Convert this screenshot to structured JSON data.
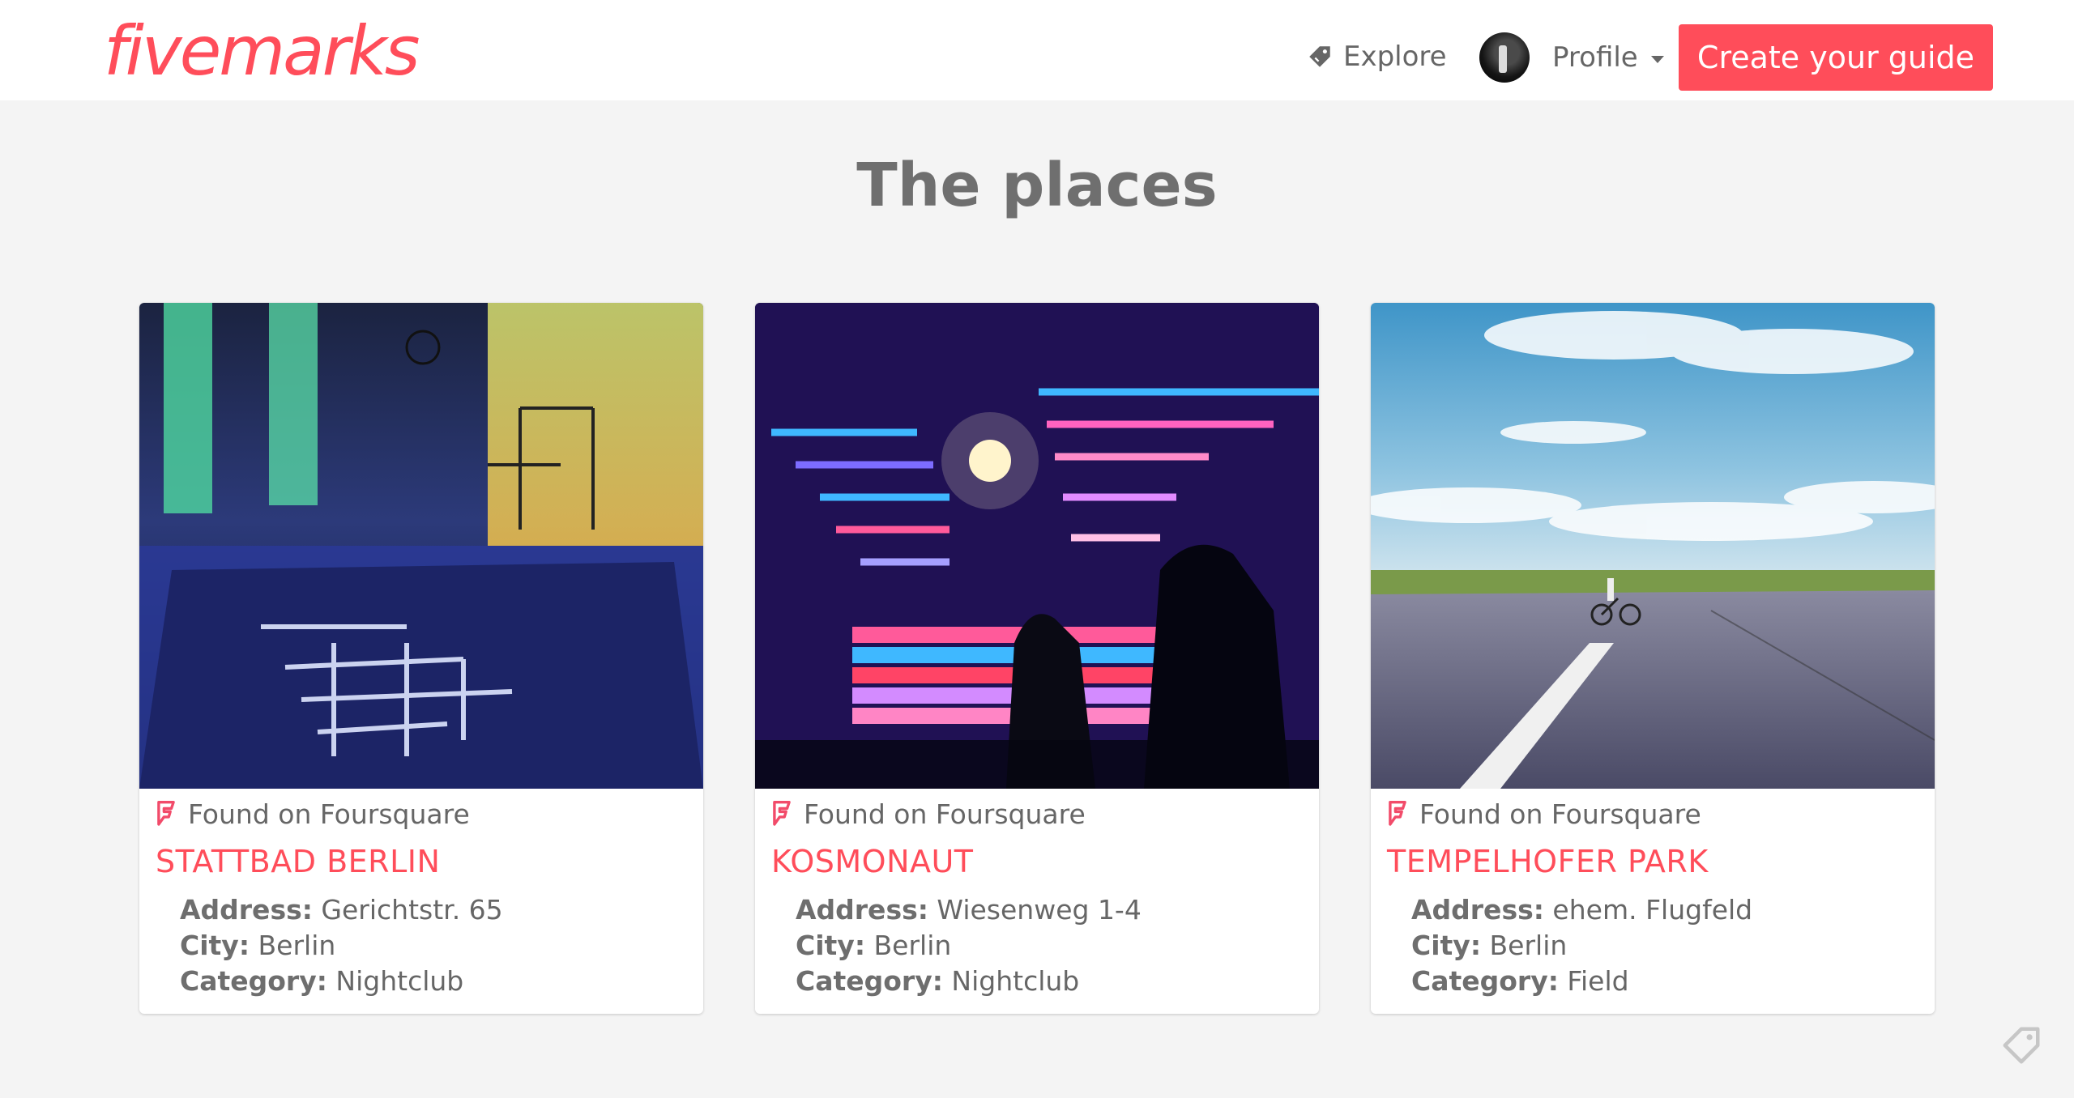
{
  "header": {
    "logo": "fivemarks",
    "explore_label": "Explore",
    "profile_label": "Profile",
    "cta_label": "Create your guide"
  },
  "page": {
    "title": "The places"
  },
  "labels": {
    "address": "Address:",
    "city": "City:",
    "category": "Category:"
  },
  "colors": {
    "brand": "#ff4d5a",
    "background": "#f4f4f4"
  },
  "places": [
    {
      "source": "Found on Foursquare",
      "name": "STATTBAD BERLIN",
      "address": "Gerichtstr. 65",
      "city": "Berlin",
      "category": "Nightclub"
    },
    {
      "source": "Found on Foursquare",
      "name": "KOSMONAUT",
      "address": "Wiesenweg 1-4",
      "city": "Berlin",
      "category": "Nightclub"
    },
    {
      "source": "Found on Foursquare",
      "name": "TEMPELHOFER PARK",
      "address": "ehem. Flugfeld",
      "city": "Berlin",
      "category": "Field"
    }
  ]
}
